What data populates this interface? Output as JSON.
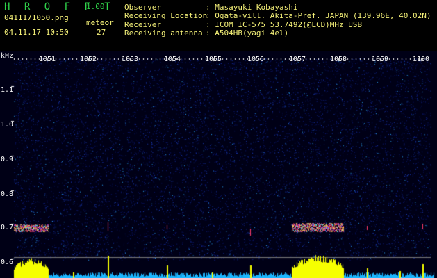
{
  "app": {
    "name": "H R O F F T",
    "version": "1.00"
  },
  "file": {
    "name": "0411171050.png",
    "datetime": "04.11.17 10:50"
  },
  "meteor": {
    "label": "meteor",
    "count": "27"
  },
  "info": {
    "observer_label": "Observer",
    "observer_value": ": Masayuki Kobayashi",
    "location_label": "Receiving Location",
    "location_value": ": Ogata-vill. Akita-Pref. JAPAN (139.96E, 40.02N)",
    "receiver_label": "Receiver",
    "receiver_value": ": ICOM IC-575 53.7492(@LCD)MHz USB",
    "antenna_label": "Receiving antenna",
    "antenna_value": ": A504HB(yagi 4el)"
  },
  "axis": {
    "unit": "kHz",
    "freq_ticks": [
      "1051",
      "1052",
      "1053",
      "1054",
      "1055",
      "1056",
      "1057",
      "1058",
      "1059",
      "1100"
    ],
    "y_ticks": [
      "1.1",
      "1.0",
      "0.9",
      "0.8",
      "0.7",
      "0.6"
    ]
  },
  "colors": {
    "app": "#2fd24a",
    "info": "#f4f078",
    "background": "#000016",
    "echo": "#ff3b6b",
    "spectrum": "#f6ff00"
  }
}
